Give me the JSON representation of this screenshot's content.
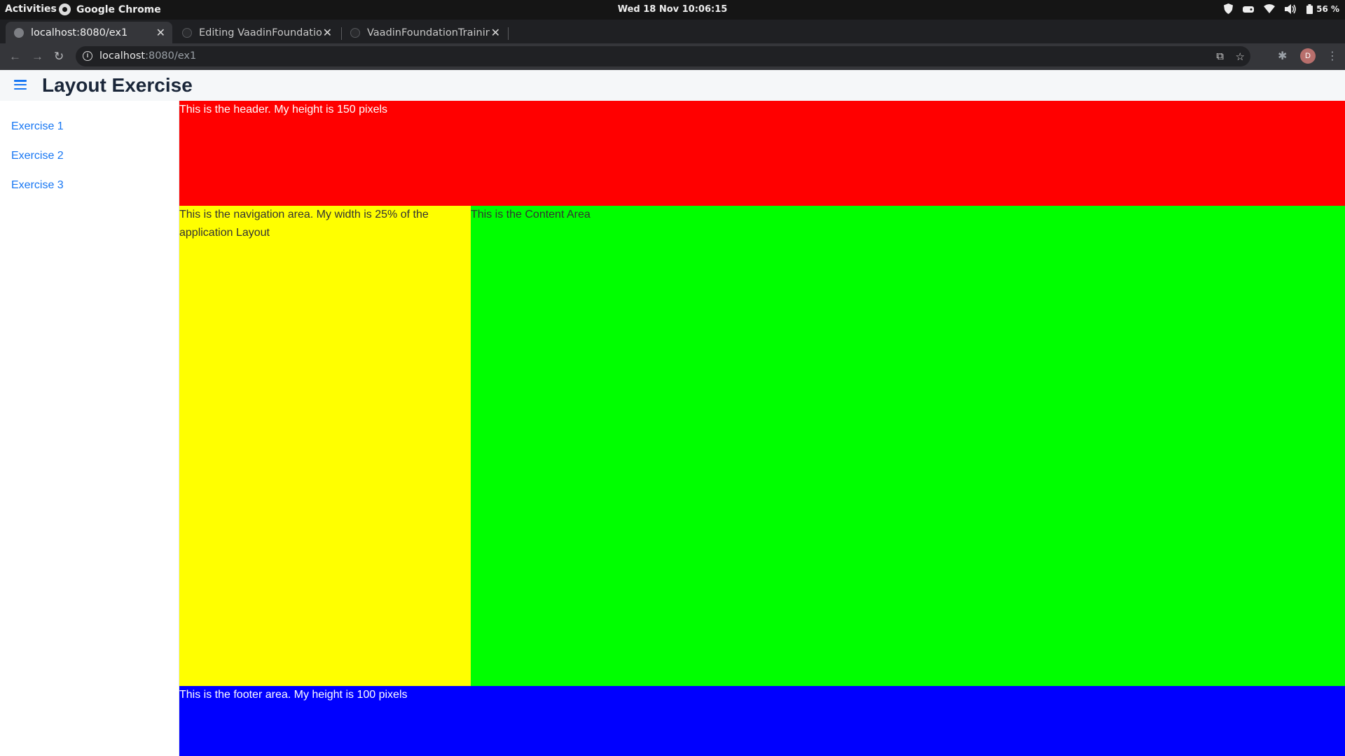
{
  "system_bar": {
    "activities": "Activities",
    "app_name": "Google Chrome",
    "datetime": "Wed 18 Nov  10:06:15",
    "battery": "56 %"
  },
  "browser": {
    "tabs": [
      {
        "title": "localhost:8080/ex1",
        "active": true
      },
      {
        "title": "Editing VaadinFoundation",
        "active": false
      },
      {
        "title": "VaadinFoundationTrainin",
        "active": false
      }
    ],
    "address": {
      "host": "localhost",
      "path": ":8080/ex1"
    },
    "profile_initial": "D"
  },
  "app": {
    "title": "Layout Exercise",
    "drawer_links": [
      "Exercise 1",
      "Exercise 2",
      "Exercise 3"
    ],
    "areas": {
      "header": "This is the header. My height is 150 pixels",
      "navigation": "This is the navigation area. My width is 25% of the application Layout",
      "content": "This is the Content Area",
      "footer": "This is the footer area. My height is 100 pixels"
    }
  },
  "colors": {
    "header": "#ff0000",
    "navigation": "#ffff00",
    "content": "#00ff00",
    "footer": "#0000ff",
    "link": "#1676f3"
  }
}
